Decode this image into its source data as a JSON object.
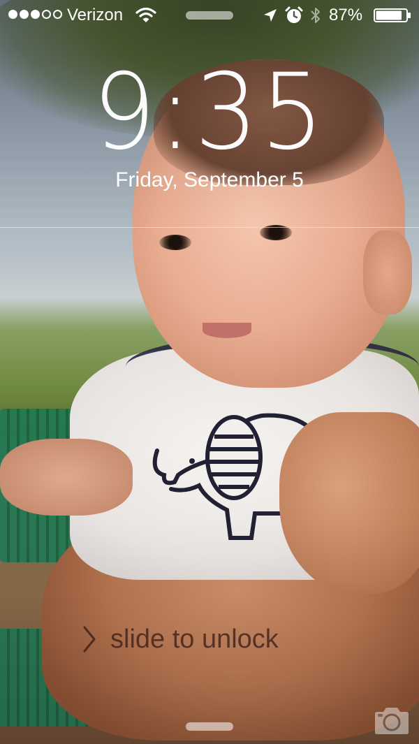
{
  "status_bar": {
    "signal_bars_filled": 3,
    "signal_bars_total": 5,
    "carrier": "Verizon",
    "battery_percent": "87%",
    "battery_level": 0.87,
    "icons": [
      "wifi-icon",
      "location-arrow-icon",
      "alarm-clock-icon",
      "bluetooth-icon",
      "battery-icon"
    ]
  },
  "lock_screen": {
    "time": "9:35",
    "date": "Friday, September 5",
    "unlock_label": "slide to unlock"
  },
  "colors": {
    "foreground": "#ffffff",
    "unlock_text": "#3c1e14"
  },
  "icons": {
    "unlock_chevron": "chevron-right-icon",
    "camera": "camera-icon"
  }
}
